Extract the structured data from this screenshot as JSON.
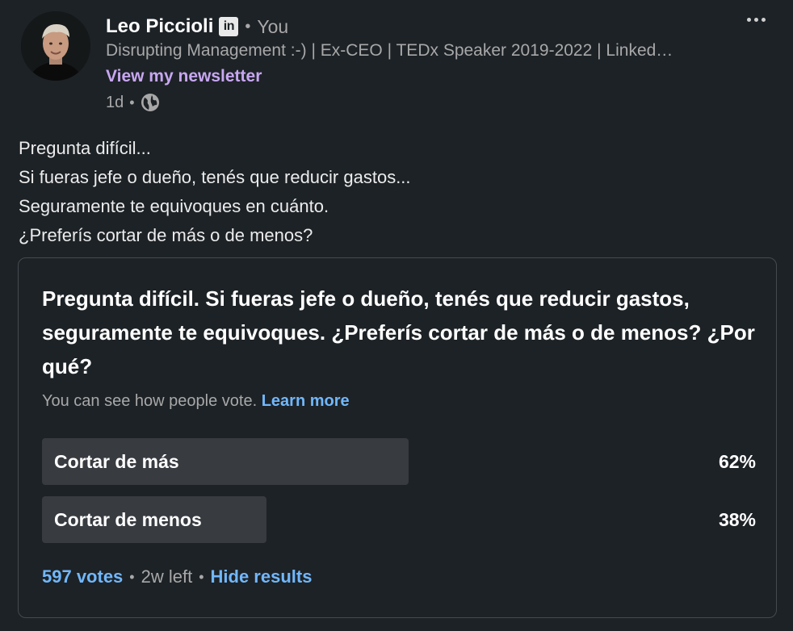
{
  "author": {
    "name": "Leo Piccioli",
    "badge": "in",
    "separator": "•",
    "relation": "You",
    "headline": "Disrupting Management :-) | Ex-CEO | TEDx Speaker 2019-2022 | Linked…",
    "newsletter_link": "View my newsletter",
    "posted": "1d",
    "visibility_icon": "globe-icon"
  },
  "menu": {
    "icon": "more-options-icon"
  },
  "post": {
    "lines": [
      "Pregunta difícil...",
      "Si fueras jefe o dueño, tenés que reducir gastos...",
      "Seguramente te equivoques en cuánto.",
      "¿Preferís cortar de más o de menos?"
    ]
  },
  "poll": {
    "question": "Pregunta difícil. Si fueras jefe o dueño, tenés que reducir gastos, seguramente te equivoques. ¿Preferís cortar de más o de menos? ¿Por qué?",
    "notice": "You can see how people vote.",
    "learn_more": "Learn more",
    "options": [
      {
        "label": "Cortar de más",
        "percent": "62%",
        "share": 0.62
      },
      {
        "label": "Cortar de menos",
        "percent": "38%",
        "share": 0.38
      }
    ],
    "votes": "597 votes",
    "time_left": "2w left",
    "hide_results": "Hide results"
  },
  "colors": {
    "background": "#1d2226",
    "link": "#71b7fb",
    "newsletter": "#c8a7f2",
    "bar": "#383b40"
  }
}
